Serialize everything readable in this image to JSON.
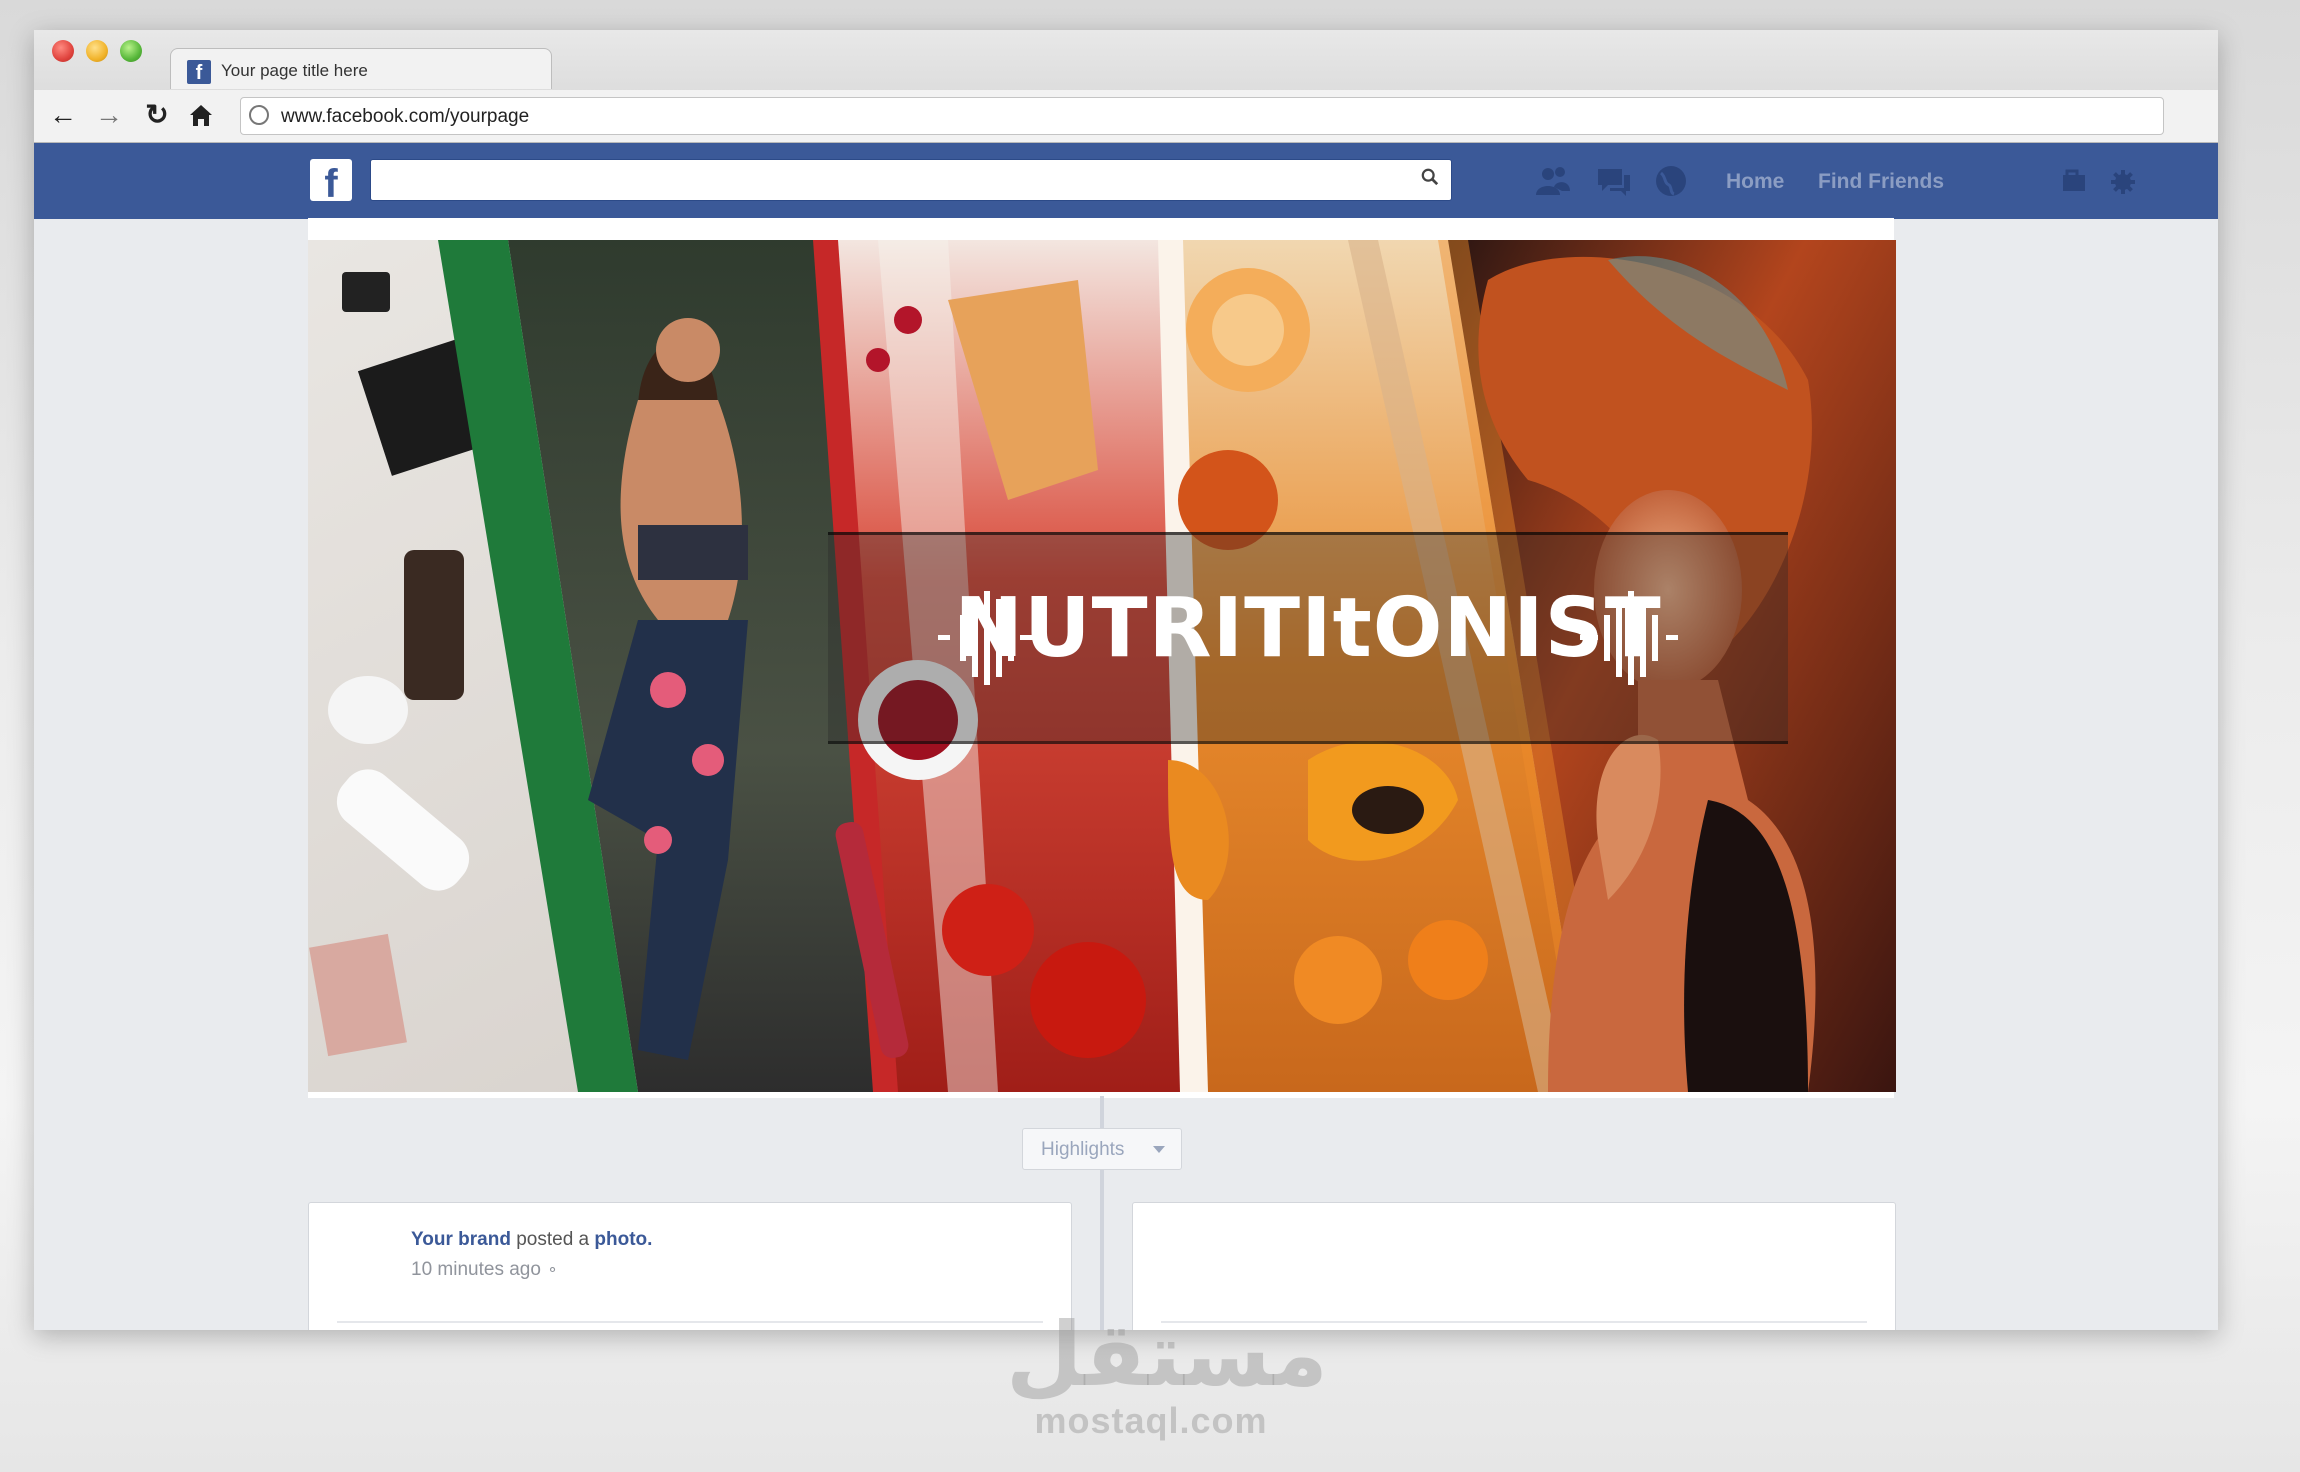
{
  "browser": {
    "tab_title": "Your page title here",
    "url": "www.facebook.com/yourpage",
    "nav_icons": [
      "back-arrow-icon",
      "forward-arrow-icon",
      "reload-icon",
      "home-icon"
    ]
  },
  "facebook": {
    "logo": "f",
    "search_placeholder": "",
    "nav_links": {
      "home": "Home",
      "find_friends": "Find Friends"
    },
    "nav_icons": [
      "friends-icon",
      "messages-icon",
      "notifications-globe-icon"
    ],
    "right_icons": [
      "privacy-shortcuts-icon",
      "settings-gear-icon"
    ],
    "brand_color": "#3b5998"
  },
  "cover": {
    "brand_name": "NUTRITItONIST",
    "panels": [
      "cosmetics",
      "runner",
      "red-food",
      "orange-fruit",
      "model-hair"
    ],
    "accent_colors": [
      "#1f7a3a",
      "#c62828",
      "#ef8c2a"
    ]
  },
  "timeline": {
    "highlights_label": "Highlights"
  },
  "post": {
    "author": "Your brand",
    "action": "posted a",
    "object": "photo.",
    "time": "10 minutes ago"
  },
  "watermark": {
    "arabic": "مستقل",
    "latin": "mostaql.com"
  }
}
